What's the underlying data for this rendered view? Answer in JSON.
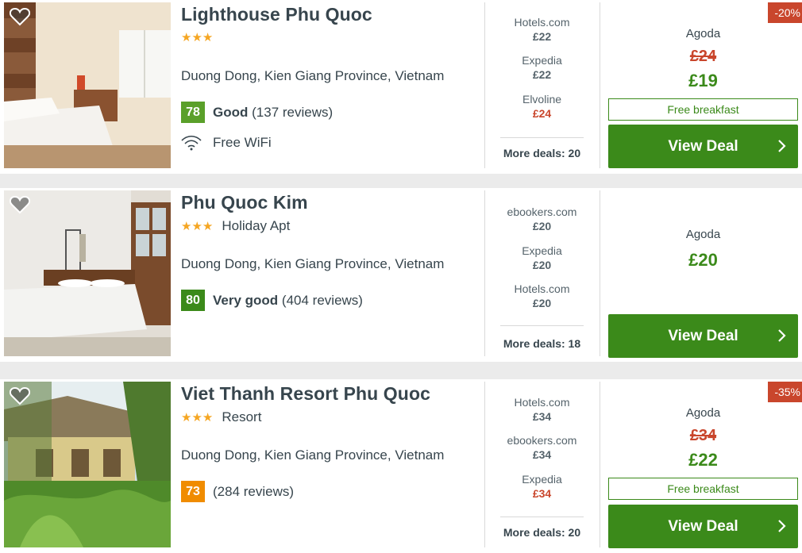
{
  "colors": {
    "accent_green": "#3b8a1a",
    "red": "#c9462c",
    "star": "#f5a623",
    "score_green": "#4a9a1e",
    "score_orange": "#f08c00"
  },
  "hotels": [
    {
      "name": "Lighthouse Phu Quoc",
      "stars": "★★★",
      "type": "",
      "location": "Duong Dong, Kien Giang Province, Vietnam",
      "score": "78",
      "rating_word": "Good",
      "reviews": "(137 reviews)",
      "amenity": "Free WiFi",
      "deals": [
        {
          "source": "Hotels.com",
          "price": "£22"
        },
        {
          "source": "Expedia",
          "price": "£22"
        },
        {
          "source": "Elvoline",
          "price": "£24"
        }
      ],
      "more_deals": "More deals: 20",
      "discount": "-20%",
      "provider": "Agoda",
      "old_price": "£24",
      "price": "£19",
      "perk": "Free breakfast",
      "button": "View Deal"
    },
    {
      "name": "Phu Quoc Kim",
      "stars": "★★★",
      "type": "Holiday Apt",
      "location": "Duong Dong, Kien Giang Province, Vietnam",
      "score": "80",
      "rating_word": "Very good",
      "reviews": "(404 reviews)",
      "deals": [
        {
          "source": "ebookers.com",
          "price": "£20"
        },
        {
          "source": "Expedia",
          "price": "£20"
        },
        {
          "source": "Hotels.com",
          "price": "£20"
        }
      ],
      "more_deals": "More deals: 18",
      "provider": "Agoda",
      "price": "£20",
      "button": "View Deal"
    },
    {
      "name": "Viet Thanh Resort Phu Quoc",
      "stars": "★★★",
      "type": "Resort",
      "location": "Duong Dong, Kien Giang Province, Vietnam",
      "score": "73",
      "reviews": "(284 reviews)",
      "deals": [
        {
          "source": "Hotels.com",
          "price": "£34"
        },
        {
          "source": "ebookers.com",
          "price": "£34"
        },
        {
          "source": "Expedia",
          "price": "£34"
        }
      ],
      "more_deals": "More deals: 20",
      "discount": "-35%",
      "provider": "Agoda",
      "old_price": "£34",
      "price": "£22",
      "perk": "Free breakfast",
      "button": "View Deal"
    }
  ]
}
